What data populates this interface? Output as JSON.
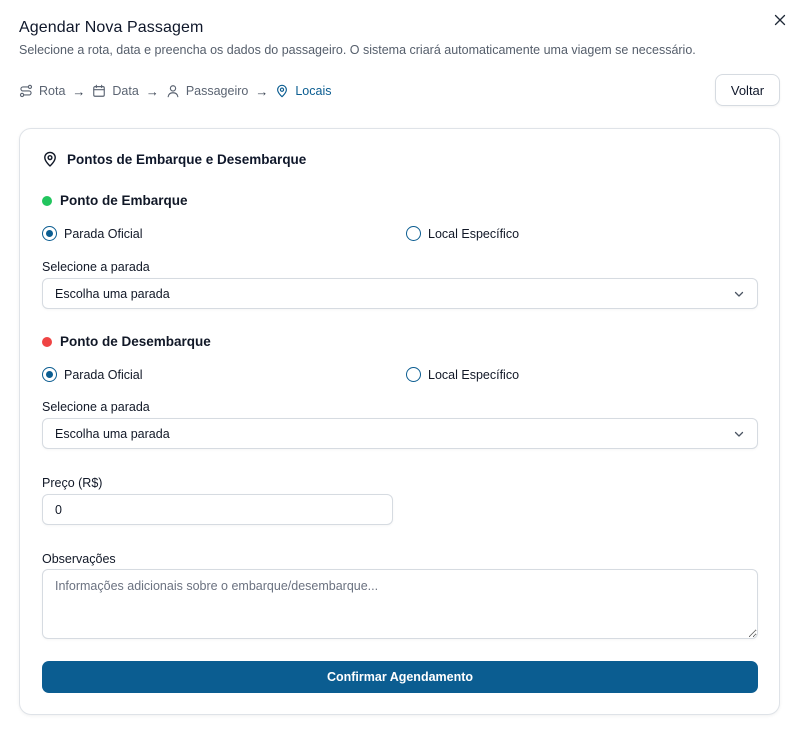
{
  "dialog": {
    "title": "Agendar Nova Passagem",
    "subtitle": "Selecione a rota, data e preencha os dados do passageiro. O sistema criará automaticamente uma viagem se necessário."
  },
  "steps": [
    {
      "label": "Rota",
      "icon": "route-icon",
      "active": false
    },
    {
      "label": "Data",
      "icon": "calendar-icon",
      "active": false
    },
    {
      "label": "Passageiro",
      "icon": "user-icon",
      "active": false
    },
    {
      "label": "Locais",
      "icon": "map-pin-icon",
      "active": true
    }
  ],
  "arrow": "→",
  "back_button": "Voltar",
  "card": {
    "title": "Pontos de Embarque e Desembarque",
    "boarding": {
      "title": "Ponto de Embarque",
      "dot_color": "#22c55e",
      "options": [
        "Parada Oficial",
        "Local Específico"
      ],
      "selected": "Parada Oficial",
      "select_label": "Selecione a parada",
      "select_value": "Escolha uma parada"
    },
    "alighting": {
      "title": "Ponto de Desembarque",
      "dot_color": "#ef4444",
      "options": [
        "Parada Oficial",
        "Local Específico"
      ],
      "selected": "Parada Oficial",
      "select_label": "Selecione a parada",
      "select_value": "Escolha uma parada"
    },
    "price": {
      "label": "Preço (R$)",
      "value": "0"
    },
    "notes": {
      "label": "Observações",
      "placeholder": "Informações adicionais sobre o embarque/desembarque..."
    },
    "confirm_button": "Confirmar Agendamento"
  },
  "colors": {
    "accent": "#0b5d91"
  }
}
